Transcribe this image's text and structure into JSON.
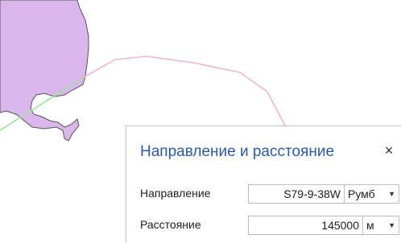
{
  "colors": {
    "land_fill": "#d9b7ed",
    "land_stroke": "#555555",
    "track_line": "#f2b6c6",
    "bearing_line": "#9be39b",
    "title_accent": "#2b5aa5"
  },
  "dialog": {
    "title": "Направление и расстояние",
    "close_icon": "×",
    "direction": {
      "label": "Направление",
      "value": "S79-9-38W",
      "unit": "Румб"
    },
    "distance": {
      "label": "Расстояние",
      "value": "145000",
      "unit": "м"
    }
  },
  "icons": {
    "close": "close-icon",
    "dropdown": "chevron-down-icon"
  }
}
